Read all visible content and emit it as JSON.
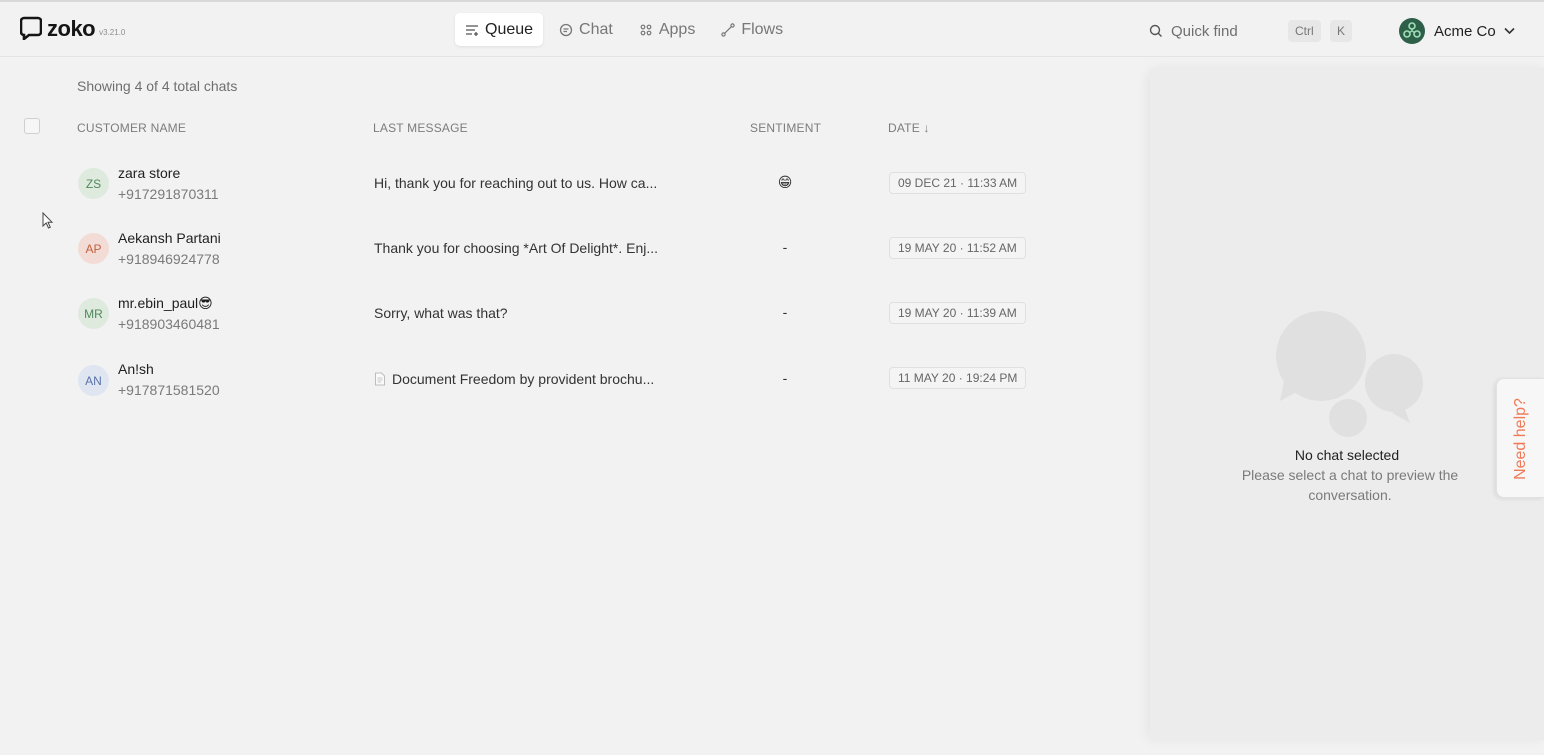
{
  "app": {
    "logo_text": "zoko",
    "version": "v3.21.0"
  },
  "nav": {
    "items": [
      {
        "label": "Queue",
        "icon": "queue-icon",
        "active": true
      },
      {
        "label": "Chat",
        "icon": "chat-icon",
        "active": false
      },
      {
        "label": "Apps",
        "icon": "apps-icon",
        "active": false
      },
      {
        "label": "Flows",
        "icon": "flows-icon",
        "active": false
      }
    ]
  },
  "search": {
    "placeholder": "Quick find",
    "shortcut_ctrl": "Ctrl",
    "shortcut_key": "K"
  },
  "account": {
    "name": "Acme Co"
  },
  "list": {
    "summary": "Showing 4 of 4 total chats",
    "columns": {
      "customer": "CUSTOMER NAME",
      "last_message": "LAST MESSAGE",
      "sentiment": "SENTIMENT",
      "date": "DATE ↓"
    },
    "rows": [
      {
        "initials": "ZS",
        "name": "zara store",
        "phone": "+917291870311",
        "last_message": "Hi, thank you for reaching out to us. How ca...",
        "sentiment": "😁",
        "date": "09 DEC 21 · 11:33 AM",
        "avatar_bg": "#dfeadf",
        "avatar_fg": "#4f8a5b"
      },
      {
        "initials": "AP",
        "name": "Aekansh Partani",
        "phone": "+918946924778",
        "last_message": "Thank you for choosing *Art Of Delight*. Enj...",
        "sentiment": "-",
        "date": "19 MAY 20 · 11:52 AM",
        "avatar_bg": "#f3dcd5",
        "avatar_fg": "#c0603f"
      },
      {
        "initials": "MR",
        "name": "mr.ebin_paul😎",
        "phone": "+918903460481",
        "last_message": "Sorry, what was that?",
        "sentiment": "-",
        "date": "19 MAY 20 · 11:39 AM",
        "avatar_bg": "#dfeadf",
        "avatar_fg": "#4f8a5b"
      },
      {
        "initials": "AN",
        "name": "An!sh",
        "phone": "+917871581520",
        "last_message": "Document Freedom by provident brochu...",
        "has_doc_icon": true,
        "sentiment": "-",
        "date": "11 MAY 20 · 19:24 PM",
        "avatar_bg": "#dfe5f1",
        "avatar_fg": "#5a74a8"
      }
    ]
  },
  "preview": {
    "empty_title": "No chat selected",
    "empty_subtitle": "Please select a chat to preview the conversation."
  },
  "help": {
    "label": "Need help?",
    "color": "#f07a58"
  }
}
